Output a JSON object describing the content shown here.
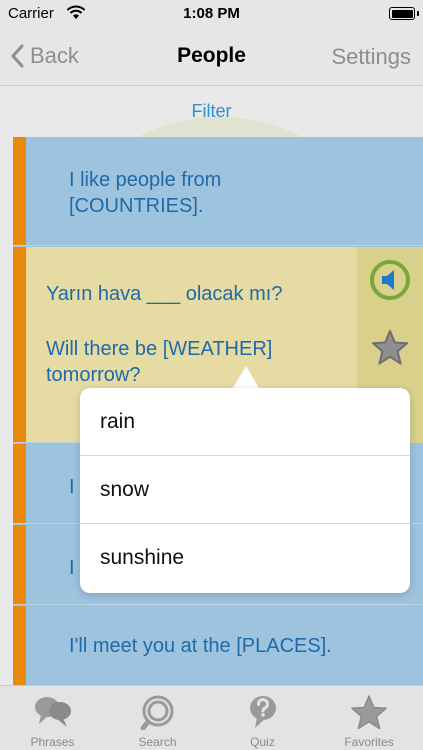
{
  "status_bar": {
    "carrier": "Carrier",
    "time": "1:08 PM"
  },
  "nav": {
    "back_label": "Back",
    "title": "People",
    "settings_label": "Settings"
  },
  "filter_label": "Filter",
  "rows": [
    {
      "text": "I like people from [COUNTRIES]."
    },
    {
      "native": "Yarın hava ___ olacak mı?",
      "translation": "Will there be [WEATHER] tomorrow?"
    },
    {
      "text": "I"
    },
    {
      "text": "I"
    },
    {
      "text": "I'll meet you at the [PLACES]."
    }
  ],
  "popover": {
    "options": [
      "rain",
      "snow",
      "sunshine"
    ]
  },
  "tabs": [
    {
      "label": "Phrases",
      "icon": "speech-bubbles-icon"
    },
    {
      "label": "Search",
      "icon": "search-icon"
    },
    {
      "label": "Quiz",
      "icon": "question-bubble-icon"
    },
    {
      "label": "Favorites",
      "icon": "star-icon"
    }
  ],
  "colors": {
    "accent_blue": "#2f8fcf",
    "row_blue": "#9ec3df",
    "row_expanded": "#e6dba3",
    "stripe_orange": "#e98a0d",
    "sound_green": "#79a83a"
  }
}
